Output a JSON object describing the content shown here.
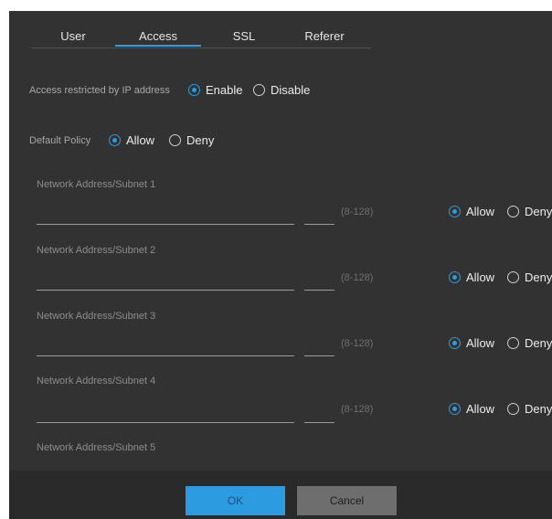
{
  "tabs": [
    {
      "label": "User",
      "active": false
    },
    {
      "label": "Access",
      "active": true
    },
    {
      "label": "SSL",
      "active": false
    },
    {
      "label": "Referer",
      "active": false
    }
  ],
  "ip_restriction": {
    "label": "Access restricted by IP address",
    "enable_label": "Enable",
    "disable_label": "Disable",
    "selected": "Enable"
  },
  "default_policy": {
    "label": "Default Policy",
    "allow_label": "Allow",
    "deny_label": "Deny",
    "selected": "Allow"
  },
  "subnets": [
    {
      "label": "Network Address/Subnet 1",
      "address": "",
      "prefix": "",
      "range_hint": "(8-128)",
      "allow_label": "Allow",
      "deny_label": "Deny",
      "selected": "Allow"
    },
    {
      "label": "Network Address/Subnet 2",
      "address": "",
      "prefix": "",
      "range_hint": "(8-128)",
      "allow_label": "Allow",
      "deny_label": "Deny",
      "selected": "Allow"
    },
    {
      "label": "Network Address/Subnet 3",
      "address": "",
      "prefix": "",
      "range_hint": "(8-128)",
      "allow_label": "Allow",
      "deny_label": "Deny",
      "selected": "Allow"
    },
    {
      "label": "Network Address/Subnet 4",
      "address": "",
      "prefix": "",
      "range_hint": "(8-128)",
      "allow_label": "Allow",
      "deny_label": "Deny",
      "selected": "Allow"
    },
    {
      "label": "Network Address/Subnet 5"
    }
  ],
  "footer": {
    "ok_label": "OK",
    "cancel_label": "Cancel"
  },
  "colors": {
    "accent": "#2d9be0",
    "panel_bg": "#323232"
  }
}
